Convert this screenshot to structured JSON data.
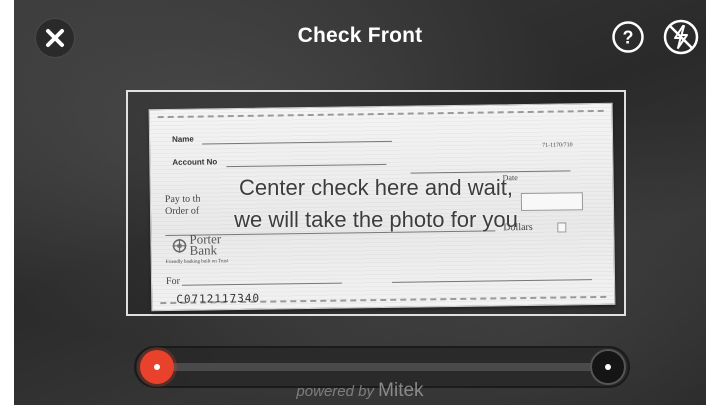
{
  "header": {
    "title": "Check Front",
    "close_icon": "close-icon",
    "help_icon": "help-icon",
    "flash_icon": "flash-off-icon"
  },
  "check": {
    "name_label": "Name",
    "account_label": "Account No",
    "routing_fraction": "71-1170/710",
    "date_label": "Date",
    "pay_to_label": "Pay to th",
    "order_of_label": "Order of",
    "dollars_label": "Dollars",
    "bank_line1": "Porter",
    "bank_line2": "Bank",
    "bank_tagline": "Friendly banking built on Trust",
    "for_label": "For",
    "micr": "C0712117340"
  },
  "overlay": {
    "instruction_line1": "Center check here and wait,",
    "instruction_line2": "we will take the photo for you"
  },
  "footer": {
    "powered_prefix": "powered by",
    "brand": "Mitek"
  },
  "colors": {
    "accent": "#e8412c",
    "background": "#2f2f2f",
    "title": "#ffffff"
  }
}
